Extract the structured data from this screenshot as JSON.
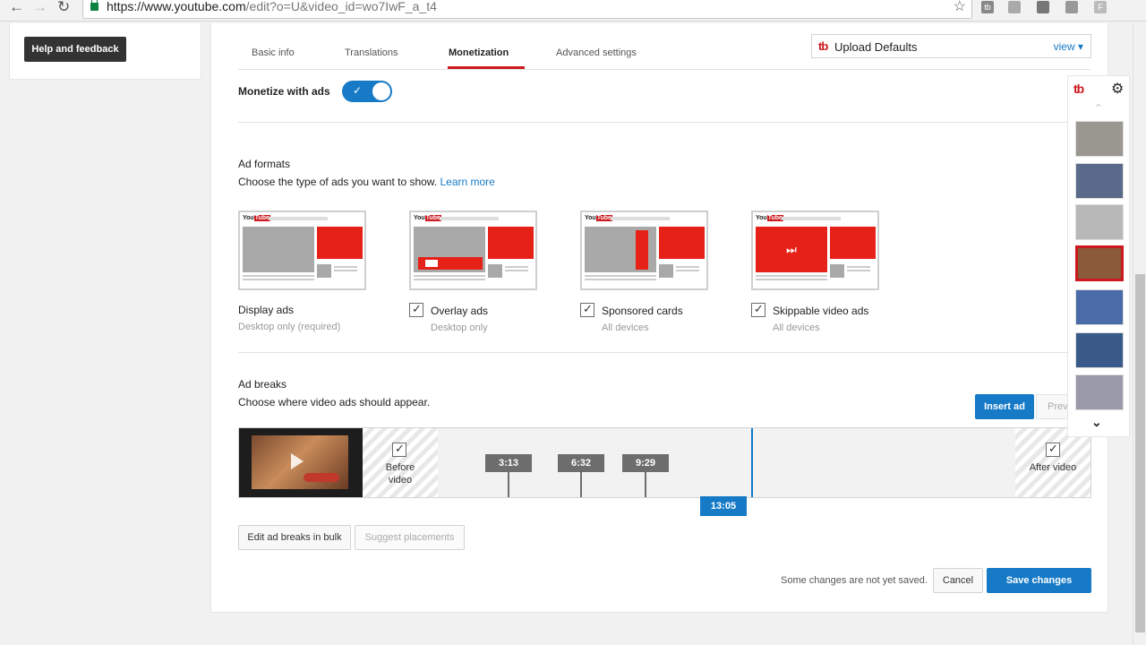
{
  "browser": {
    "url_host": "https://www.youtube.com",
    "url_path": "/edit?o=U&video_id=wo7IwF_a_t4",
    "extensions": [
      "tb",
      "",
      "",
      "",
      "F"
    ]
  },
  "sidebar": {
    "help_label": "Help and feedback"
  },
  "tabs": [
    {
      "label": "Basic info"
    },
    {
      "label": "Translations"
    },
    {
      "label": "Monetization"
    },
    {
      "label": "Advanced settings"
    }
  ],
  "upload_defaults": {
    "logo": "tb",
    "label": "Upload Defaults",
    "view": "view ▾"
  },
  "monetize": {
    "label": "Monetize with ads",
    "enabled": true
  },
  "ad_formats": {
    "title": "Ad formats",
    "subtitle": "Choose the type of ads you want to show.",
    "learn_more": "Learn more",
    "items": [
      {
        "label": "Display ads",
        "sub": "Desktop only (required)",
        "checked": null
      },
      {
        "label": "Overlay ads",
        "sub": "Desktop only",
        "checked": true
      },
      {
        "label": "Sponsored cards",
        "sub": "All devices",
        "checked": true
      },
      {
        "label": "Skippable video ads",
        "sub": "All devices",
        "checked": true
      }
    ]
  },
  "ad_breaks": {
    "title": "Ad breaks",
    "subtitle": "Choose where video ads should appear.",
    "insert_label": "Insert ad",
    "preview_label": "Preview",
    "before_label": "Before video",
    "after_label": "After video",
    "markers": [
      "3:13",
      "6:32",
      "9:29"
    ],
    "playhead": "13:05"
  },
  "buttons": {
    "bulk": "Edit ad breaks in bulk",
    "suggest": "Suggest placements",
    "unsaved": "Some changes are not yet saved.",
    "cancel": "Cancel",
    "save": "Save changes"
  },
  "tubebuddy": {
    "logo": "tb"
  },
  "colors": {
    "accent": "#167ac6",
    "brand_red": "#cc181e"
  }
}
